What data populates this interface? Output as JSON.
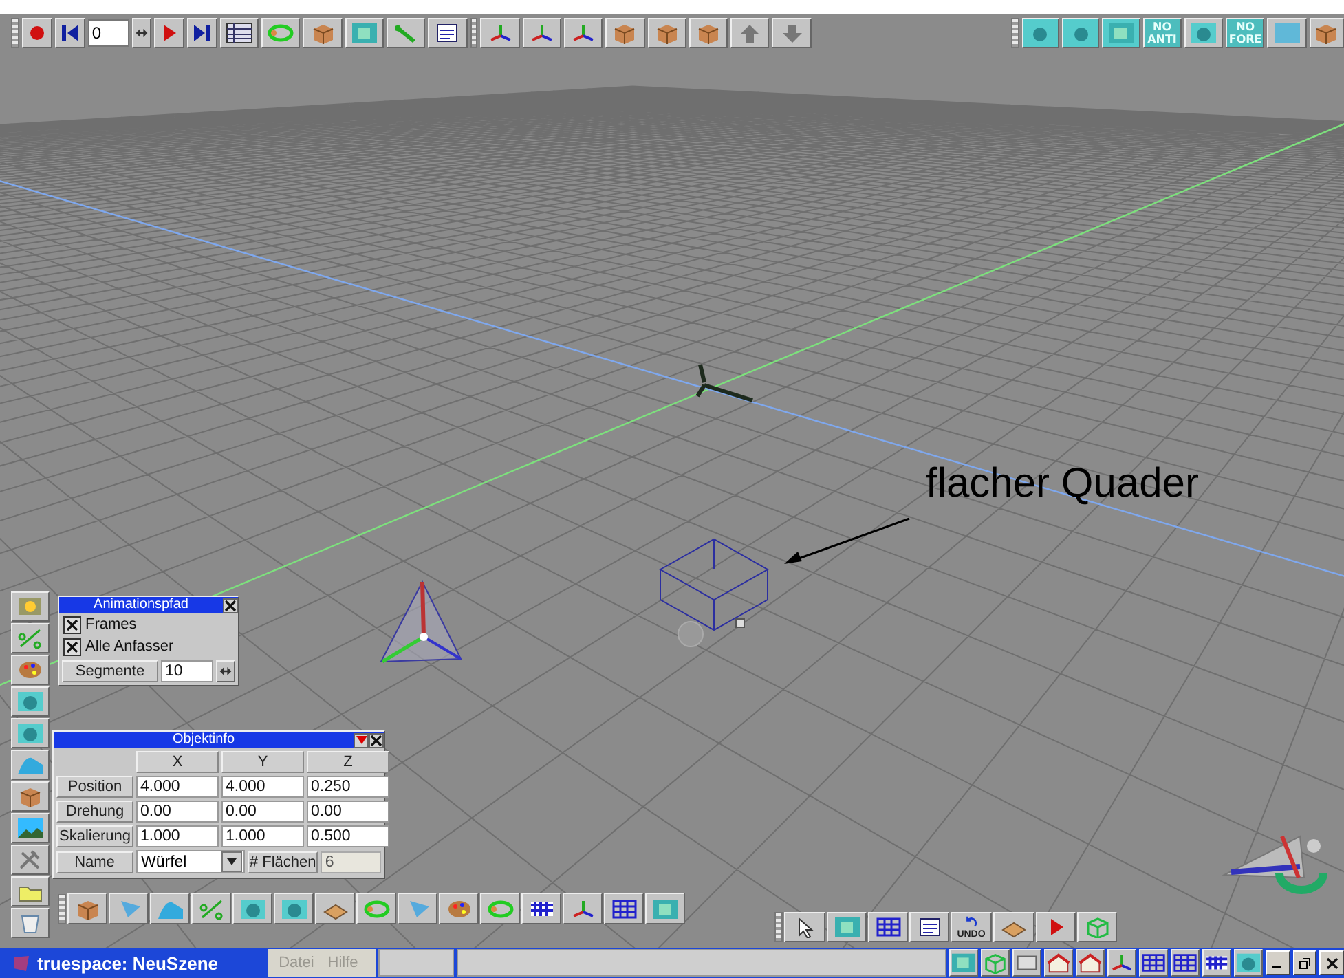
{
  "top_toolbar": {
    "frame_field": {
      "value": "0"
    },
    "render_toggles": [
      {
        "label": "NO ANTI"
      },
      {
        "label": "NO FORE"
      }
    ]
  },
  "viewport": {
    "annotation": "flacher Quader"
  },
  "animation_path_panel": {
    "title": "Animationspfad",
    "options": [
      {
        "label": "Frames",
        "checked": true
      },
      {
        "label": "Alle Anfasser",
        "checked": true
      }
    ],
    "segments": {
      "label": "Segmente",
      "value": "10"
    }
  },
  "object_info_panel": {
    "title": "Objektinfo",
    "columns": [
      "X",
      "Y",
      "Z"
    ],
    "rows": [
      {
        "label": "Position",
        "values": [
          "4.000",
          "4.000",
          "0.250"
        ]
      },
      {
        "label": "Drehung",
        "values": [
          "0.00",
          "0.00",
          "0.00"
        ]
      },
      {
        "label": "Skalierung",
        "values": [
          "1.000",
          "1.000",
          "0.500"
        ]
      }
    ],
    "name": {
      "label": "Name",
      "value": "Würfel"
    },
    "faces": {
      "label": "# Flächen",
      "value": "6"
    }
  },
  "bottom_right_toolbar": {
    "undo_label": "UNDO"
  },
  "taskbar": {
    "title": "truespace: NeuSzene",
    "menu": [
      "Datei",
      "Hilfe"
    ]
  }
}
